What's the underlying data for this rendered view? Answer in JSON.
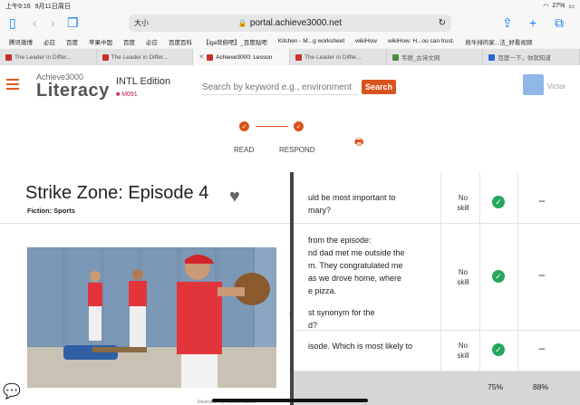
{
  "status": {
    "time": "上午9:16",
    "date": "9月11日周日",
    "battery": "27%"
  },
  "browser": {
    "aa_label": "大小",
    "url": "portal.achieve3000.net"
  },
  "bookmarks": [
    "腾讯微博",
    "必应",
    "百度",
    "苹果中国",
    "百度",
    "必应",
    "百度百科",
    "【iga背俯吧】_百度贴吧",
    "Kitchen - M...g worksheet",
    "wikiHow",
    "wikiHow: H...ou can trust.",
    "煎牛排的家...法_好看视频"
  ],
  "tabs": [
    {
      "label": "The Leader in Differ...",
      "active": false
    },
    {
      "label": "The Leader in Differ...",
      "active": false
    },
    {
      "label": "Achieve3000: Lesson",
      "active": true
    },
    {
      "label": "The Leader in Differ...",
      "active": false
    },
    {
      "label": "韦德_古诗文网",
      "active": false
    },
    {
      "label": "百度一下，你就知道",
      "active": false
    }
  ],
  "app": {
    "brand_top": "Achieve3000",
    "brand_main": "Literacy",
    "edition": "INTL Edition",
    "module": "M091",
    "search_placeholder": "Search by keyword e.g., environment",
    "search_button": "Search",
    "user_name": "Victor"
  },
  "steps": [
    {
      "label": "READ",
      "done": true
    },
    {
      "label": "RESPOND",
      "done": true
    }
  ],
  "story": {
    "title": "Strike Zone: Episode 4",
    "genre": "Fiction: Sports",
    "caption": "Illustration by Robert Fatzika"
  },
  "questions": [
    {
      "lines": [
        "uld be most important to",
        "mary?"
      ],
      "skill": [
        "No",
        "skill"
      ],
      "correct": true,
      "retry": "–"
    },
    {
      "lines": [
        "from the episode:",
        "nd dad met me outside the",
        "m. They congratulated me",
        "as we drove home, where",
        "e pizza.",
        "",
        "st synonym for the",
        "d?"
      ],
      "skill": [
        "No",
        "skill"
      ],
      "correct": true,
      "retry": "–"
    },
    {
      "lines": [
        "isode. Which is most likely to"
      ],
      "skill": [
        "No",
        "skill"
      ],
      "correct": true,
      "retry": "–"
    }
  ],
  "totals": {
    "first": "75%",
    "second": "88%"
  },
  "colors": {
    "accent": "#d9531e",
    "correct": "#26a65b",
    "module": "#c2185b"
  }
}
